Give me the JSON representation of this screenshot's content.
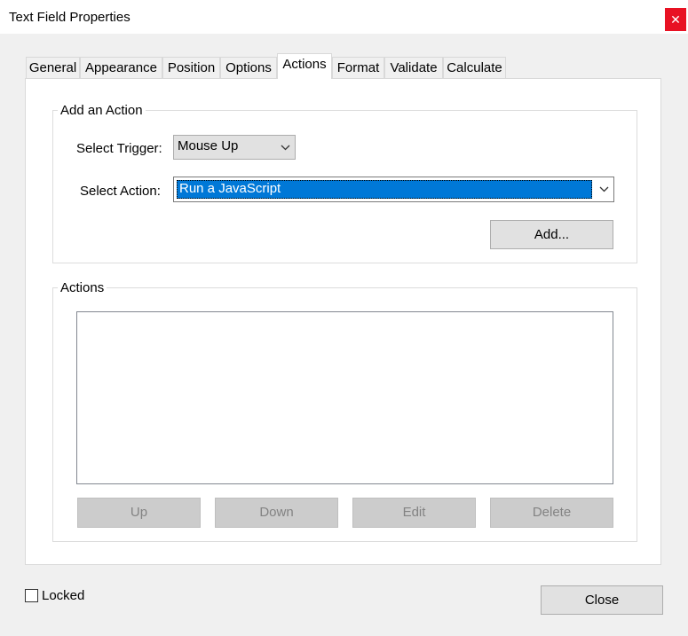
{
  "window": {
    "title": "Text Field Properties"
  },
  "tabs": [
    {
      "label": "General"
    },
    {
      "label": "Appearance"
    },
    {
      "label": "Position"
    },
    {
      "label": "Options"
    },
    {
      "label": "Actions",
      "active": true
    },
    {
      "label": "Format"
    },
    {
      "label": "Validate"
    },
    {
      "label": "Calculate"
    }
  ],
  "add_action": {
    "group_label": "Add an Action",
    "trigger_label": "Select Trigger:",
    "trigger_value": "Mouse Up",
    "action_label": "Select Action:",
    "action_value": "Run a JavaScript",
    "add_button": "Add..."
  },
  "actions": {
    "group_label": "Actions",
    "buttons": {
      "up": "Up",
      "down": "Down",
      "edit": "Edit",
      "delete": "Delete"
    }
  },
  "footer": {
    "locked_label": "Locked",
    "locked_checked": false,
    "close_button": "Close"
  },
  "colors": {
    "selection": "#0078d7",
    "close_red": "#e81123"
  }
}
